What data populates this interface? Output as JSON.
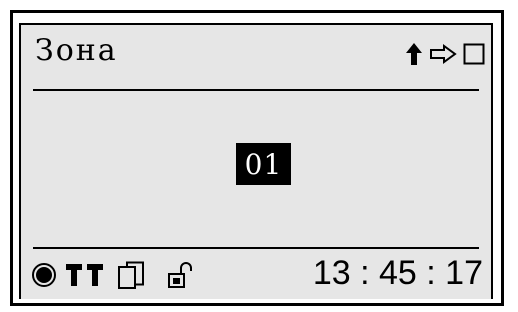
{
  "screen": {
    "title": "Зона",
    "zone_number": "01",
    "time": "13 : 45 : 17"
  },
  "icons": {
    "top": [
      "arrow-up-icon",
      "arrow-right-outline-icon",
      "square-icon"
    ],
    "bottom": [
      "record-dot-icon",
      "signal-bars-icon",
      "copy-pages-icon",
      "unlocked-padlock-icon"
    ]
  },
  "colors": {
    "background": "#e6e6e6",
    "foreground": "#000000",
    "highlight_text": "#ffffff"
  }
}
